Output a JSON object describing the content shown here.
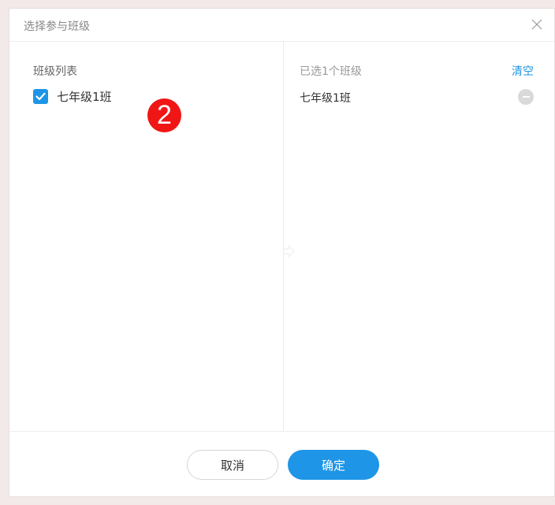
{
  "dialog": {
    "title": "选择参与班级",
    "close_icon": "close-icon"
  },
  "left_pane": {
    "heading": "班级列表",
    "items": [
      {
        "label": "七年级1班",
        "checked": true
      }
    ],
    "step_badge": "2"
  },
  "right_pane": {
    "heading": "已选1个班级",
    "clear_label": "清空",
    "selected": [
      {
        "label": "七年级1班"
      }
    ]
  },
  "footer": {
    "cancel_label": "取消",
    "confirm_label": "确定"
  },
  "colors": {
    "accent": "#1e95e6",
    "badge": "#f01616"
  }
}
